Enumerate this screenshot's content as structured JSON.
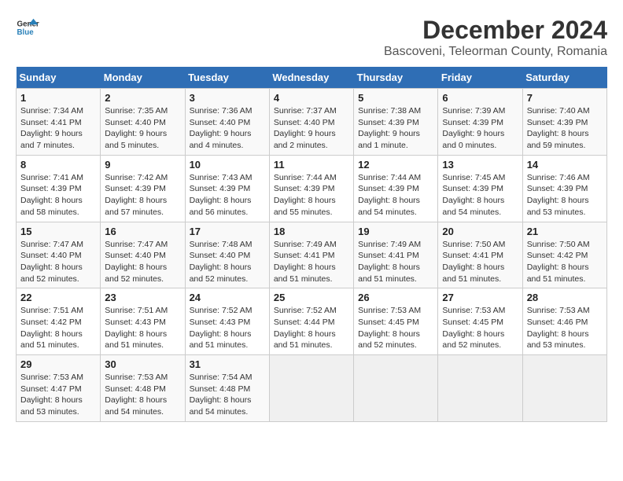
{
  "header": {
    "logo_line1": "General",
    "logo_line2": "Blue",
    "title": "December 2024",
    "subtitle": "Bascoveni, Teleorman County, Romania"
  },
  "weekdays": [
    "Sunday",
    "Monday",
    "Tuesday",
    "Wednesday",
    "Thursday",
    "Friday",
    "Saturday"
  ],
  "weeks": [
    [
      {
        "day": "1",
        "sunrise": "7:34 AM",
        "sunset": "4:41 PM",
        "daylight": "9 hours and 7 minutes."
      },
      {
        "day": "2",
        "sunrise": "7:35 AM",
        "sunset": "4:40 PM",
        "daylight": "9 hours and 5 minutes."
      },
      {
        "day": "3",
        "sunrise": "7:36 AM",
        "sunset": "4:40 PM",
        "daylight": "9 hours and 4 minutes."
      },
      {
        "day": "4",
        "sunrise": "7:37 AM",
        "sunset": "4:40 PM",
        "daylight": "9 hours and 2 minutes."
      },
      {
        "day": "5",
        "sunrise": "7:38 AM",
        "sunset": "4:39 PM",
        "daylight": "9 hours and 1 minute."
      },
      {
        "day": "6",
        "sunrise": "7:39 AM",
        "sunset": "4:39 PM",
        "daylight": "9 hours and 0 minutes."
      },
      {
        "day": "7",
        "sunrise": "7:40 AM",
        "sunset": "4:39 PM",
        "daylight": "8 hours and 59 minutes."
      }
    ],
    [
      {
        "day": "8",
        "sunrise": "7:41 AM",
        "sunset": "4:39 PM",
        "daylight": "8 hours and 58 minutes."
      },
      {
        "day": "9",
        "sunrise": "7:42 AM",
        "sunset": "4:39 PM",
        "daylight": "8 hours and 57 minutes."
      },
      {
        "day": "10",
        "sunrise": "7:43 AM",
        "sunset": "4:39 PM",
        "daylight": "8 hours and 56 minutes."
      },
      {
        "day": "11",
        "sunrise": "7:44 AM",
        "sunset": "4:39 PM",
        "daylight": "8 hours and 55 minutes."
      },
      {
        "day": "12",
        "sunrise": "7:44 AM",
        "sunset": "4:39 PM",
        "daylight": "8 hours and 54 minutes."
      },
      {
        "day": "13",
        "sunrise": "7:45 AM",
        "sunset": "4:39 PM",
        "daylight": "8 hours and 54 minutes."
      },
      {
        "day": "14",
        "sunrise": "7:46 AM",
        "sunset": "4:39 PM",
        "daylight": "8 hours and 53 minutes."
      }
    ],
    [
      {
        "day": "15",
        "sunrise": "7:47 AM",
        "sunset": "4:40 PM",
        "daylight": "8 hours and 52 minutes."
      },
      {
        "day": "16",
        "sunrise": "7:47 AM",
        "sunset": "4:40 PM",
        "daylight": "8 hours and 52 minutes."
      },
      {
        "day": "17",
        "sunrise": "7:48 AM",
        "sunset": "4:40 PM",
        "daylight": "8 hours and 52 minutes."
      },
      {
        "day": "18",
        "sunrise": "7:49 AM",
        "sunset": "4:41 PM",
        "daylight": "8 hours and 51 minutes."
      },
      {
        "day": "19",
        "sunrise": "7:49 AM",
        "sunset": "4:41 PM",
        "daylight": "8 hours and 51 minutes."
      },
      {
        "day": "20",
        "sunrise": "7:50 AM",
        "sunset": "4:41 PM",
        "daylight": "8 hours and 51 minutes."
      },
      {
        "day": "21",
        "sunrise": "7:50 AM",
        "sunset": "4:42 PM",
        "daylight": "8 hours and 51 minutes."
      }
    ],
    [
      {
        "day": "22",
        "sunrise": "7:51 AM",
        "sunset": "4:42 PM",
        "daylight": "8 hours and 51 minutes."
      },
      {
        "day": "23",
        "sunrise": "7:51 AM",
        "sunset": "4:43 PM",
        "daylight": "8 hours and 51 minutes."
      },
      {
        "day": "24",
        "sunrise": "7:52 AM",
        "sunset": "4:43 PM",
        "daylight": "8 hours and 51 minutes."
      },
      {
        "day": "25",
        "sunrise": "7:52 AM",
        "sunset": "4:44 PM",
        "daylight": "8 hours and 51 minutes."
      },
      {
        "day": "26",
        "sunrise": "7:53 AM",
        "sunset": "4:45 PM",
        "daylight": "8 hours and 52 minutes."
      },
      {
        "day": "27",
        "sunrise": "7:53 AM",
        "sunset": "4:45 PM",
        "daylight": "8 hours and 52 minutes."
      },
      {
        "day": "28",
        "sunrise": "7:53 AM",
        "sunset": "4:46 PM",
        "daylight": "8 hours and 53 minutes."
      }
    ],
    [
      {
        "day": "29",
        "sunrise": "7:53 AM",
        "sunset": "4:47 PM",
        "daylight": "8 hours and 53 minutes."
      },
      {
        "day": "30",
        "sunrise": "7:53 AM",
        "sunset": "4:48 PM",
        "daylight": "8 hours and 54 minutes."
      },
      {
        "day": "31",
        "sunrise": "7:54 AM",
        "sunset": "4:48 PM",
        "daylight": "8 hours and 54 minutes."
      },
      null,
      null,
      null,
      null
    ]
  ],
  "labels": {
    "sunrise": "Sunrise:",
    "sunset": "Sunset:",
    "daylight": "Daylight:"
  }
}
